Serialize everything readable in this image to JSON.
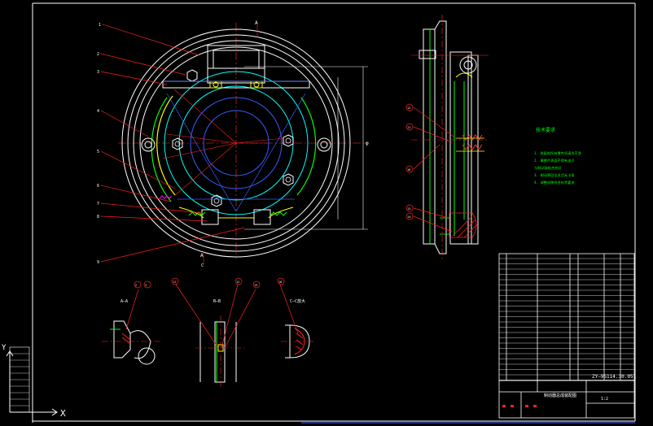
{
  "colors": {
    "background": "#000000",
    "frame": "#ffffff",
    "red": "#ff2020",
    "green": "#00ff00",
    "cyan": "#00ffff",
    "blue": "#3c5cff",
    "yellow": "#ffff00",
    "magenta": "#ff00ff"
  },
  "main_view": {
    "callouts": [
      "1",
      "2",
      "3",
      "4",
      "5",
      "6",
      "7",
      "8",
      "9"
    ],
    "section_mark_top": "A",
    "section_mark_bottom": "A",
    "section_mark_c": "C",
    "dim_vertical": "φ"
  },
  "side_view": {
    "callouts": [
      "12",
      "11",
      "10",
      "13",
      "14"
    ]
  },
  "notes": {
    "title": "技术要求",
    "lines": [
      "1. 装配前所有零件须清洗干净",
      "2. 摩擦片表面不得有油污",
      "   与制动鼓贴合良好",
      "3. 制动蹄回位灵活无卡滞",
      "4. 调整间隙符合技术要求"
    ]
  },
  "detail_views": {
    "aa": {
      "label": "A—A",
      "callouts": [
        "2",
        "3"
      ]
    },
    "bb": {
      "label": "B—B",
      "callouts": [
        "11",
        "12",
        "13"
      ]
    },
    "cc": {
      "label": "C—C放大",
      "callouts": [
        "10"
      ]
    }
  },
  "title_block": {
    "drawing_no": "ZY—95114.30.051",
    "title": "制动器总成装配图",
    "scale": "1:2"
  },
  "ucs": {
    "x_label": "X",
    "y_label": "Y"
  }
}
